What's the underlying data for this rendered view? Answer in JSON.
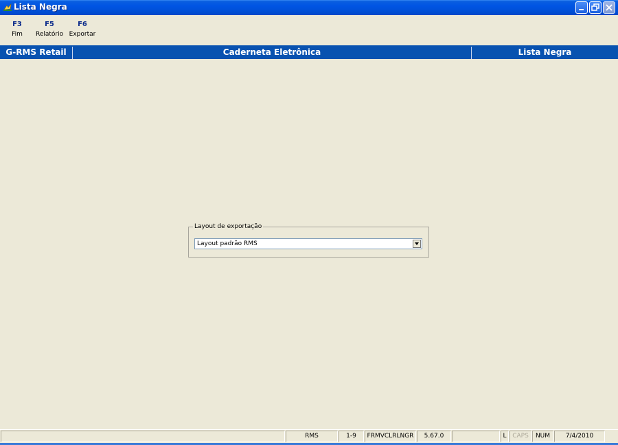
{
  "window": {
    "title": "Lista Negra",
    "icon": "app-icon"
  },
  "fkeys": [
    {
      "key": "F3",
      "label": "Fim"
    },
    {
      "key": "F5",
      "label": "Relatório"
    },
    {
      "key": "F6",
      "label": "Exportar"
    }
  ],
  "header": {
    "left": "G-RMS Retail",
    "center": "Caderneta Eletrônica",
    "right": "Lista Negra"
  },
  "export": {
    "group_label": "Layout de exportação",
    "selected": "Layout padrão RMS"
  },
  "status": {
    "module": "RMS",
    "code": "1-9",
    "form": "FRMVCLRLNGR",
    "version": "5.67.0",
    "l": "L",
    "caps": "CAPS",
    "num": "NUM",
    "date": "7/4/2010"
  },
  "colors": {
    "titlebar": "#0054e3",
    "header_band": "#0852b0",
    "background": "#ece9d8"
  }
}
